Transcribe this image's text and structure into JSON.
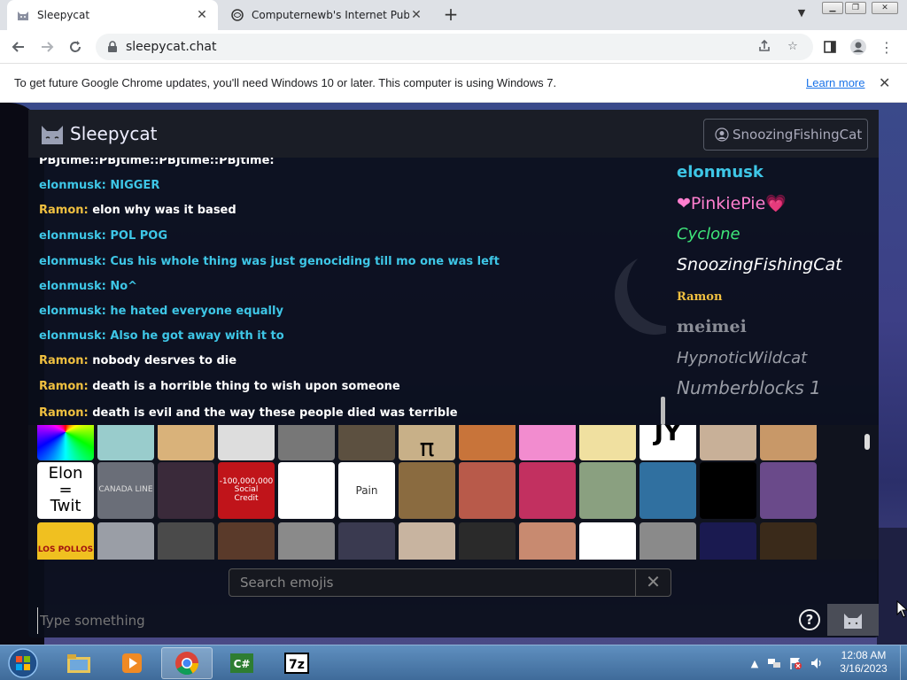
{
  "browser": {
    "tabs": [
      {
        "title": "Sleepycat",
        "active": true
      },
      {
        "title": "Computernewb's Internet Pub Hu",
        "active": false
      }
    ],
    "url": "sleepycat.chat",
    "infobar": {
      "message": "To get future Google Chrome updates, you'll need Windows 10 or later. This computer is using Windows 7.",
      "link": "Learn more"
    }
  },
  "app": {
    "title": "Sleepycat",
    "username": "SnoozingFishingCat",
    "messages": [
      {
        "author": "",
        "text": "PBJtime::PBJtime::PBJtime::PBJtime:",
        "author_color": "#ffffff",
        "text_color": "#ffffff"
      },
      {
        "author": "elonmusk:",
        "text": "NIGGER",
        "author_color": "#3ec6e6",
        "text_color": "#3ec6e6"
      },
      {
        "author": "Ramon:",
        "text": "elon why was it based",
        "author_color": "#f0c040",
        "text_color": "#ffffff"
      },
      {
        "author": "elonmusk:",
        "text": "POL POG",
        "author_color": "#3ec6e6",
        "text_color": "#3ec6e6"
      },
      {
        "author": "elonmusk:",
        "text": "Cus his whole thing was just genociding till mo one was left",
        "author_color": "#3ec6e6",
        "text_color": "#3ec6e6"
      },
      {
        "author": "elonmusk:",
        "text": "No^",
        "author_color": "#3ec6e6",
        "text_color": "#3ec6e6"
      },
      {
        "author": "elonmusk:",
        "text": "he hated everyone equally",
        "author_color": "#3ec6e6",
        "text_color": "#3ec6e6"
      },
      {
        "author": "elonmusk:",
        "text": "Also he got away with it to",
        "author_color": "#3ec6e6",
        "text_color": "#3ec6e6"
      },
      {
        "author": "Ramon:",
        "text": "nobody desrves to die",
        "author_color": "#f0c040",
        "text_color": "#ffffff"
      },
      {
        "author": "Ramon:",
        "text": "death is a horrible thing to wish upon someone",
        "author_color": "#f0c040",
        "text_color": "#ffffff"
      },
      {
        "author": "Ramon:",
        "text": "death is evil and the way these people died was terrible",
        "author_color": "#f0c040",
        "text_color": "#ffffff"
      }
    ],
    "users": [
      {
        "name": "elonmusk",
        "color": "#3ec6e6"
      },
      {
        "name": "❤PinkiePie💗",
        "color": "#ff7fcf"
      },
      {
        "name": "Cyclone",
        "color": "#3ee67a"
      },
      {
        "name": "SnoozingFishingCat",
        "color": "#ffffff"
      },
      {
        "name": "Ramon",
        "color": "#f0c040"
      },
      {
        "name": "meimei",
        "color": "#8a8d96"
      },
      {
        "name": "HypnoticWildcat",
        "color": "#9a9da6"
      },
      {
        "name": "Numberblocks 1",
        "color": "#9a9da6"
      }
    ],
    "emoji_search_placeholder": "Search emojis",
    "compose_placeholder": "Type something",
    "help_label": "?",
    "emoji_text": {
      "elon_twit": "Elon\n=\nTwit",
      "canada_line": "CANADA LINE",
      "paint": "Pain",
      "pi": "π",
      "jy": "JY",
      "los_pollos": "LOS POLLOS",
      "red_money": "-100,000,000\nSocial\nCredit"
    }
  },
  "taskbar": {
    "time": "12:08 AM",
    "date": "3/16/2023"
  }
}
